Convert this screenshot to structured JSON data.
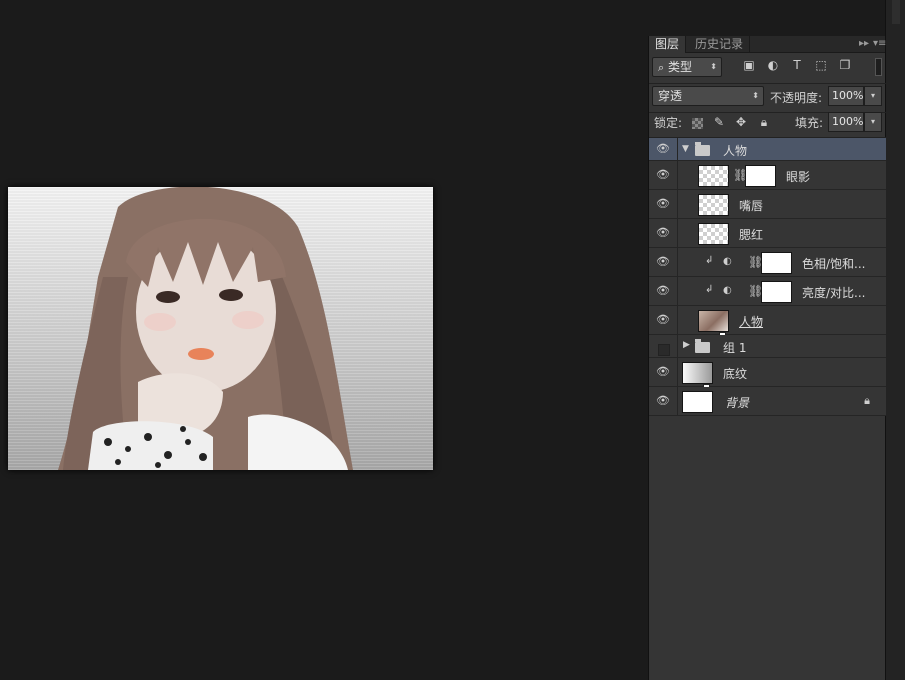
{
  "panel": {
    "tabs": [
      "图层",
      "历史记录"
    ],
    "tab_controls": {
      "collapse": "▸▸",
      "menu": "▾≡"
    },
    "filter": {
      "label": "类型",
      "icons": [
        "image-filter-icon",
        "adjustment-filter-icon",
        "text-filter-icon",
        "shape-filter-icon",
        "smart-object-filter-icon"
      ]
    },
    "blend_mode": "穿透",
    "opacity_label": "不透明度:",
    "opacity_value": "100%",
    "lock_label": "锁定:",
    "fill_label": "填充:",
    "fill_value": "100%"
  },
  "layers": [
    {
      "name": "人物",
      "type": "group",
      "visible": true,
      "expanded": true,
      "selected": true
    },
    {
      "name": "眼影",
      "type": "pixel-mask",
      "visible": true
    },
    {
      "name": "嘴唇",
      "type": "pixel",
      "visible": true
    },
    {
      "name": "腮红",
      "type": "pixel",
      "visible": true
    },
    {
      "name": "色相/饱和...",
      "type": "adjustment",
      "visible": true,
      "clipped": true
    },
    {
      "name": "亮度/对比...",
      "type": "adjustment",
      "visible": true,
      "clipped": true
    },
    {
      "name": "人物",
      "type": "smart-object",
      "visible": true
    },
    {
      "name": "组 1",
      "type": "group",
      "visible": false,
      "expanded": false
    },
    {
      "name": "底纹",
      "type": "smart-object",
      "visible": true
    },
    {
      "name": "背景",
      "type": "background",
      "visible": true,
      "locked": true
    }
  ]
}
